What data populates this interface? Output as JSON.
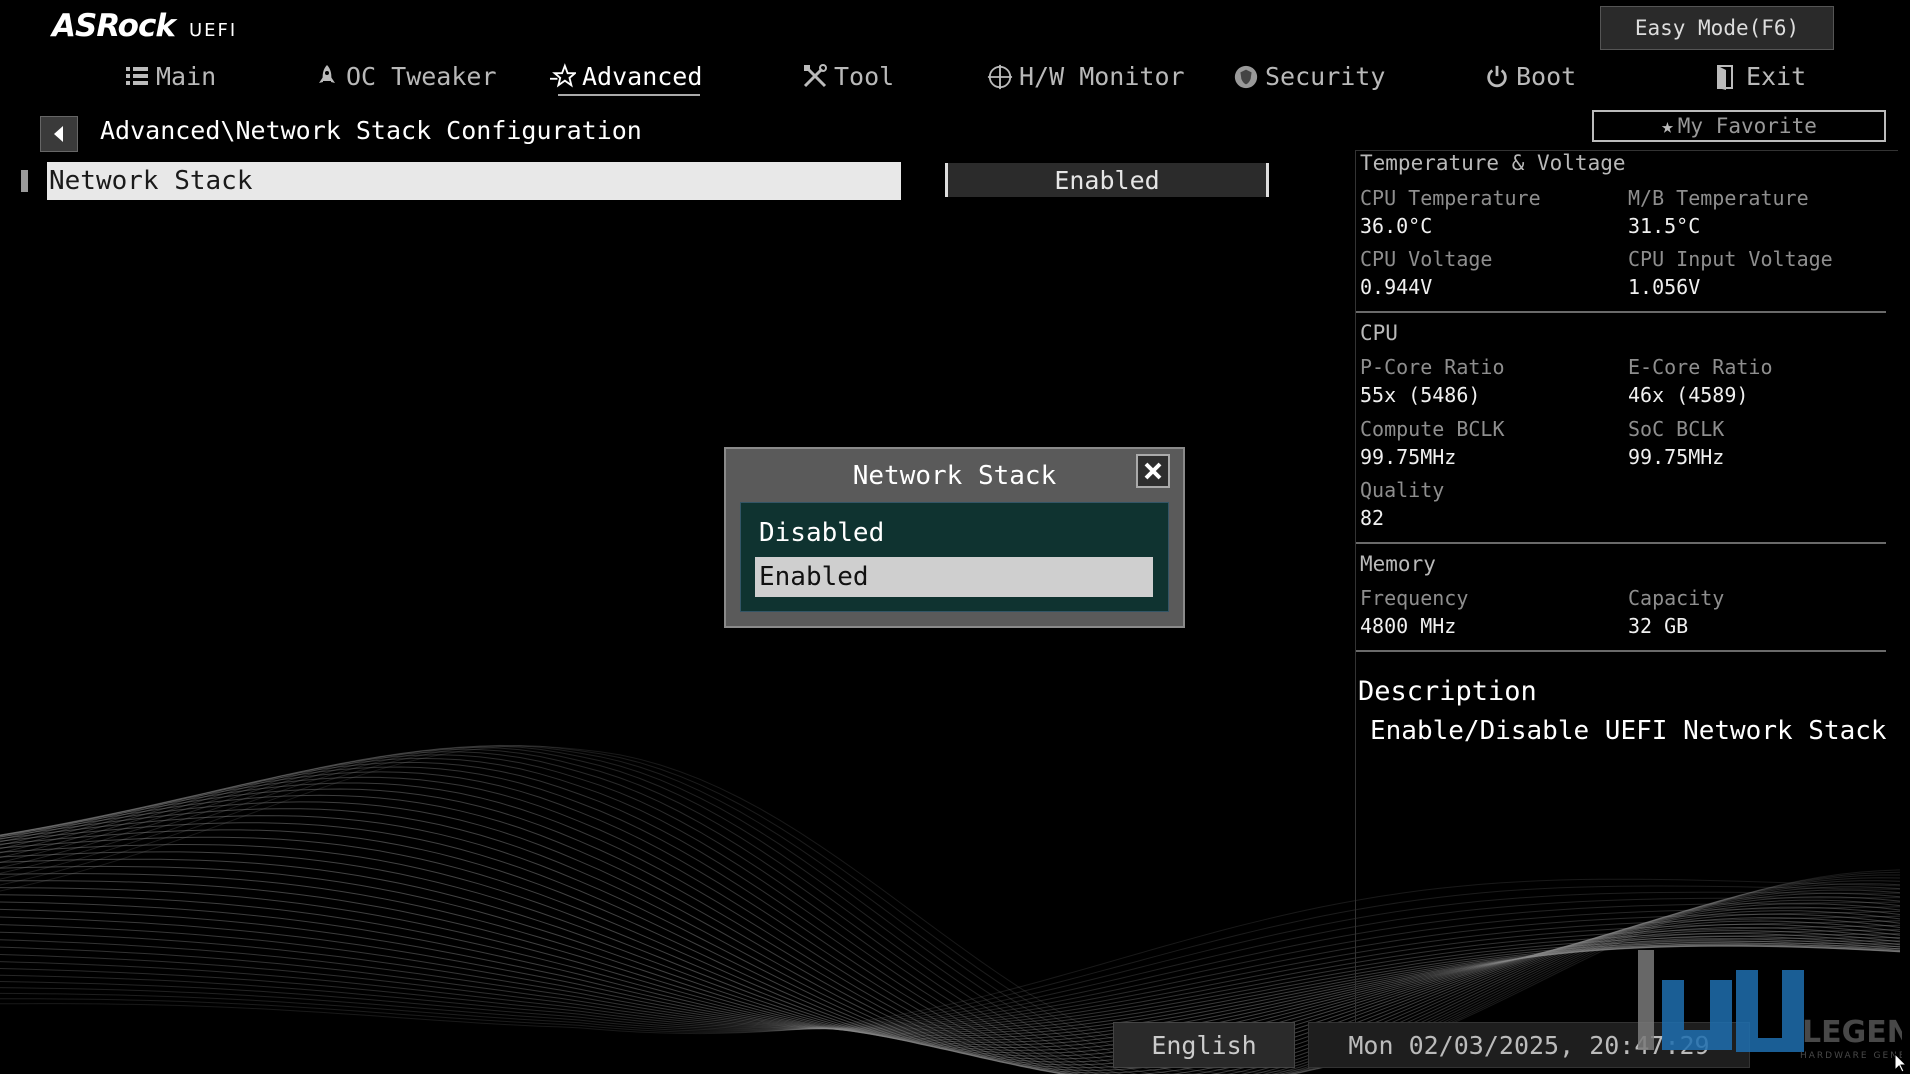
{
  "brand": {
    "name": "ASRock",
    "sub": "UEFI"
  },
  "header": {
    "easy_mode": "Easy Mode(F6)",
    "favorite": "My Favorite"
  },
  "tabs": [
    {
      "label": "Main",
      "icon": "list-icon"
    },
    {
      "label": "OC Tweaker",
      "icon": "rocket-icon"
    },
    {
      "label": "Advanced",
      "icon": "star-icon",
      "active": true
    },
    {
      "label": "Tool",
      "icon": "tools-icon"
    },
    {
      "label": "H/W Monitor",
      "icon": "monitor-icon"
    },
    {
      "label": "Security",
      "icon": "shield-icon"
    },
    {
      "label": "Boot",
      "icon": "power-icon"
    },
    {
      "label": "Exit",
      "icon": "exit-icon"
    }
  ],
  "breadcrumb": "Advanced\\Network Stack Configuration",
  "setting": {
    "label": "Network Stack",
    "value": "Enabled"
  },
  "panel": {
    "temp_title": "Temperature & Voltage",
    "cpu_temp_label": "CPU Temperature",
    "cpu_temp": "36.0°C",
    "mb_temp_label": "M/B Temperature",
    "mb_temp": "31.5°C",
    "cpu_volt_label": "CPU Voltage",
    "cpu_volt": "0.944V",
    "cpu_in_volt_label": "CPU Input Voltage",
    "cpu_in_volt": "1.056V",
    "cpu_title": "CPU",
    "pcore_label": "P-Core Ratio",
    "pcore": "55x (5486)",
    "ecore_label": "E-Core Ratio",
    "ecore": "46x (4589)",
    "bclk_label": "Compute BCLK",
    "bclk": "99.75MHz",
    "soc_label": "SoC BCLK",
    "soc": "99.75MHz",
    "quality_label": "Quality",
    "quality": "82",
    "mem_title": "Memory",
    "freq_label": "Frequency",
    "freq": "4800 MHz",
    "cap_label": "Capacity",
    "cap": "32 GB"
  },
  "description": {
    "title": "Description",
    "text": "Enable/Disable UEFI Network Stack"
  },
  "popup": {
    "title": "Network Stack",
    "options": [
      "Disabled",
      "Enabled"
    ],
    "selected": "Enabled"
  },
  "footer": {
    "language": "English",
    "datetime": "Mon 02/03/2025, 20:47:29"
  },
  "watermark": {
    "text": "LEGEND",
    "sub": "HARDWARE GENERATION"
  },
  "colors": {
    "popup_list_bg": "#0f3330",
    "selection_bg": "#e8e8e8"
  }
}
